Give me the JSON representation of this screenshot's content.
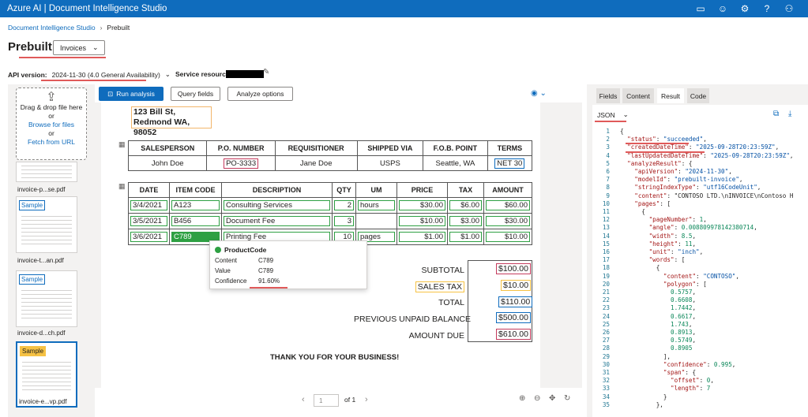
{
  "topbar": {
    "title": "Azure AI | Document Intelligence Studio",
    "icons": [
      "keyboard-icon",
      "smiley-icon",
      "settings-icon",
      "help-icon",
      "account-icon"
    ],
    "icon_glyphs": [
      "▭",
      "☺",
      "⚙",
      "?",
      "⚇"
    ]
  },
  "breadcrumb": {
    "root": "Document Intelligence Studio",
    "current": "Prebuilt"
  },
  "header": {
    "title": "Prebuilt",
    "model": "Invoices"
  },
  "api": {
    "label": "API version:",
    "value": "2024-11-30 (4.0 General Availability)",
    "service_label": "Service resource:"
  },
  "dropzone": {
    "line1": "Drag & drop file here",
    "line2": "or",
    "browse": "Browse for files",
    "line3": "or",
    "fetch": "Fetch from URL"
  },
  "thumbnails": [
    {
      "label": "invoice-p...se.pdf",
      "badge": ""
    },
    {
      "label": "invoice-t...an.pdf",
      "badge": "Sample"
    },
    {
      "label": "invoice-d...ch.pdf",
      "badge": "Sample"
    },
    {
      "label": "invoice-e...vp.pdf",
      "badge": "Sample"
    }
  ],
  "toolbar": {
    "run": "Run analysis",
    "query": "Query fields",
    "options": "Analyze options"
  },
  "doc": {
    "address": [
      "123 Bill St,",
      "Redmond WA, 98052"
    ],
    "table1": {
      "headers": [
        "SALESPERSON",
        "P.O. NUMBER",
        "REQUISITIONER",
        "SHIPPED VIA",
        "F.O.B. POINT",
        "TERMS"
      ],
      "row": [
        "John Doe",
        "PO-3333",
        "Jane Doe",
        "USPS",
        "Seattle, WA",
        "NET 30"
      ]
    },
    "table2": {
      "headers": [
        "DATE",
        "ITEM CODE",
        "DESCRIPTION",
        "QTY",
        "UM",
        "PRICE",
        "TAX",
        "AMOUNT"
      ],
      "rows": [
        [
          "3/4/2021",
          "A123",
          "Consulting Services",
          "2",
          "hours",
          "$30.00",
          "$6.00",
          "$60.00"
        ],
        [
          "3/5/2021",
          "B456",
          "Document Fee",
          "3",
          "",
          "$10.00",
          "$3.00",
          "$30.00"
        ],
        [
          "3/6/2021",
          "C789",
          "Printing Fee",
          "10",
          "pages",
          "$1.00",
          "$1.00",
          "$10.00"
        ]
      ]
    },
    "totals": [
      {
        "label": "SUBTOTAL",
        "value": "$100.00"
      },
      {
        "label": "SALES TAX",
        "value": "$10.00"
      },
      {
        "label": "TOTAL",
        "value": "$110.00"
      },
      {
        "label": "PREVIOUS UNPAID BALANCE",
        "value": "$500.00"
      },
      {
        "label": "AMOUNT DUE",
        "value": "$610.00"
      }
    ],
    "thanks": "THANK YOU FOR YOUR BUSINESS!"
  },
  "tooltip": {
    "title": "ProductCode",
    "content_label": "Content",
    "content_value": "C789",
    "value_label": "Value",
    "value_value": "C789",
    "confidence_label": "Confidence",
    "confidence_value": "91.60%"
  },
  "pager": {
    "page": "1",
    "of": "of 1"
  },
  "right": {
    "tabs": [
      "Fields",
      "Content",
      "Result",
      "Code"
    ],
    "active_tab": "Result",
    "format": "JSON"
  },
  "code_lines": [
    "{",
    "  \"status\": \"succeeded\",",
    "  \"createdDateTime\": \"2025-09-28T20:23:59Z\",",
    "  \"lastUpdatedDateTime\": \"2025-09-28T20:23:59Z\",",
    "  \"analyzeResult\": {",
    "    \"apiVersion\": \"2024-11-30\",",
    "    \"modelId\": \"prebuilt-invoice\",",
    "    \"stringIndexType\": \"utf16CodeUnit\",",
    "    \"content\": \"CONTOSO LTD.\\nINVOICE\\nContoso H",
    "    \"pages\": [",
    "      {",
    "        \"pageNumber\": 1,",
    "        \"angle\": 0.008809978142380714,",
    "        \"width\": 8.5,",
    "        \"height\": 11,",
    "        \"unit\": \"inch\",",
    "        \"words\": [",
    "          {",
    "            \"content\": \"CONTOSO\",",
    "            \"polygon\": [",
    "              0.5757,",
    "              0.6608,",
    "              1.7442,",
    "              0.6617,",
    "              1.743,",
    "              0.8913,",
    "              0.5749,",
    "              0.8905",
    "            ],",
    "            \"confidence\": 0.995,",
    "            \"span\": {",
    "              \"offset\": 0,",
    "              \"length\": 7",
    "            }",
    "          },"
  ]
}
